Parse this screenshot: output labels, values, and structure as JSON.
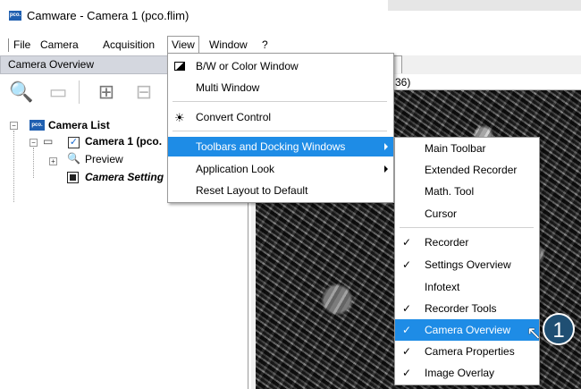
{
  "window": {
    "title": "Camware - Camera 1 (pco.flim)",
    "logo_text": "pco."
  },
  "menubar": {
    "items": [
      "File",
      "Camera",
      "Acquisition",
      "View",
      "Window",
      "?"
    ],
    "active": "View"
  },
  "camera_overview": {
    "header": "Camera Overview",
    "toolbar_icons": [
      "search-camera-icon",
      "remove-camera-icon",
      "add-camera-icon",
      "remove-item-icon"
    ],
    "tree": {
      "root": "Camera List",
      "camera": "Camera 1 (pco.",
      "camera_checked": true,
      "children": [
        "Preview",
        "Camera Setting"
      ]
    }
  },
  "image_window": {
    "info_text": "36)"
  },
  "view_menu": {
    "items": [
      {
        "label": "B/W or Color Window",
        "icon": "bw-color-icon"
      },
      {
        "label": "Multi Window"
      },
      {
        "label": "Convert Control",
        "icon": "brightness-icon"
      },
      {
        "label": "Toolbars and Docking Windows",
        "submenu": true,
        "highlighted": true
      },
      {
        "label": "Application Look",
        "submenu": true
      },
      {
        "label": "Reset Layout to Default"
      }
    ]
  },
  "toolbars_submenu": {
    "items": [
      {
        "label": "Main Toolbar",
        "checked": false
      },
      {
        "label": "Extended Recorder",
        "checked": false
      },
      {
        "label": "Math. Tool",
        "checked": false
      },
      {
        "label": "Cursor",
        "checked": false
      },
      {
        "label": "Recorder",
        "checked": true
      },
      {
        "label": "Settings Overview",
        "checked": true
      },
      {
        "label": "Infotext",
        "checked": false
      },
      {
        "label": "Recorder Tools",
        "checked": true
      },
      {
        "label": "Camera Overview",
        "checked": true,
        "highlighted": true
      },
      {
        "label": "Camera Properties",
        "checked": true
      },
      {
        "label": "Image Overlay",
        "checked": true
      }
    ],
    "check_glyph": "✓"
  },
  "annotation": {
    "step_number": "1"
  },
  "colors": {
    "highlight": "#1e8ce6",
    "pane_header": "#d4d7df",
    "badge": "#1f4f73",
    "logo": "#1f5fb0"
  }
}
